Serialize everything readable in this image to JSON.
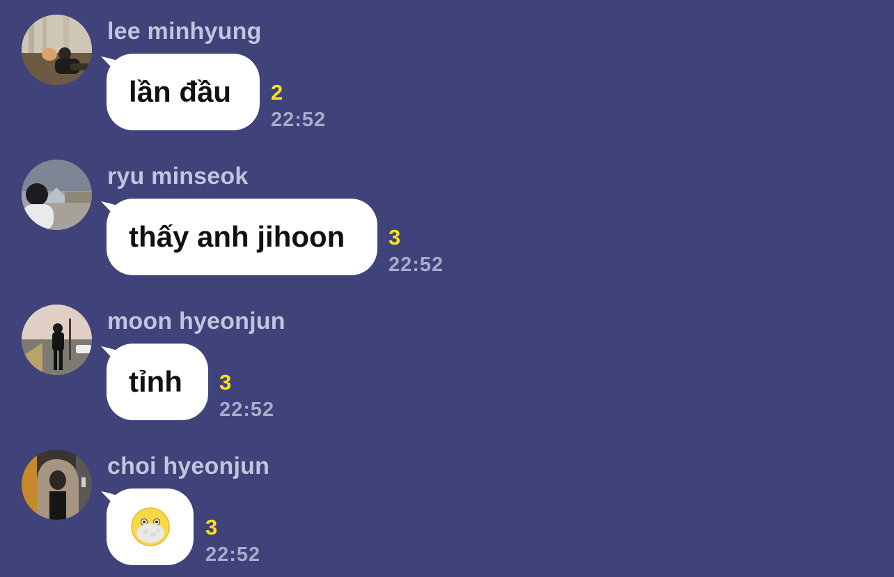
{
  "colors": {
    "background": "#40427a",
    "bubble": "#ffffff",
    "unread_count": "#ffe11a",
    "sender_name": "#c3c4de",
    "timestamp": "#a9abc9"
  },
  "messages": [
    {
      "sender": "lee minhyung",
      "avatar": "profile-photo-person-with-dog",
      "text": "lần đầu",
      "unread": "2",
      "time": "22:52"
    },
    {
      "sender": "ryu minseok",
      "avatar": "profile-photo-person-at-louvre",
      "text": "thấy anh jihoon",
      "unread": "3",
      "time": "22:52"
    },
    {
      "sender": "moon hyeonjun",
      "avatar": "profile-photo-person-on-street",
      "text": "tỉnh",
      "unread": "3",
      "time": "22:52"
    },
    {
      "sender": "choi hyeonjun",
      "avatar": "profile-photo-person-hooded-jacket",
      "emoji": "face-with-open-eyes-and-hand-over-mouth-emoji",
      "unread": "3",
      "time": "22:52"
    }
  ]
}
